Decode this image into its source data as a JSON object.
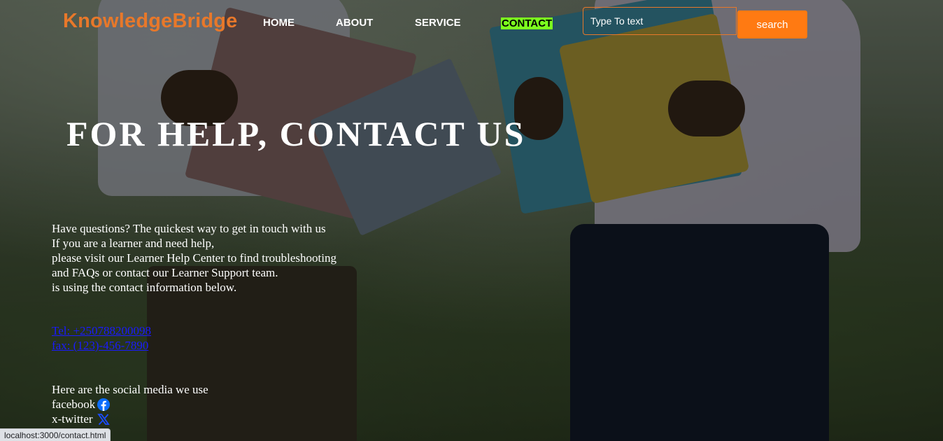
{
  "header": {
    "logo": "KnowledgeBridge",
    "nav": {
      "home": "HOME",
      "about": "ABOUT",
      "service": "SERVICE",
      "contact": "CONTACT"
    },
    "search": {
      "placeholder": "Type To text",
      "button_label": "search"
    }
  },
  "hero": {
    "title": "FOR HELP, CONTACT US"
  },
  "info": {
    "lines": [
      "Have questions? The quickest way to get in touch with us",
      "If you are a learner and need help,",
      "please visit our Learner Help Center to find troubleshooting",
      "and FAQs or contact our Learner Support team.",
      "is using the contact information below."
    ]
  },
  "contact": {
    "tel": "Tel: +250788200098",
    "fax": "fax: (123)-456-7890"
  },
  "social": {
    "intro": "Here are the social media we use",
    "facebook_label": "facebook",
    "twitter_label": "x-twitter",
    "facebook_icon": "facebook-icon",
    "twitter_icon": "x-twitter-icon"
  },
  "status_bar": {
    "url": "localhost:3000/contact.html"
  },
  "colors": {
    "brand": "#e8782a",
    "search_button": "#ff7a12",
    "active_nav_bg": "#7cff1e",
    "link": "#1a1aff"
  }
}
